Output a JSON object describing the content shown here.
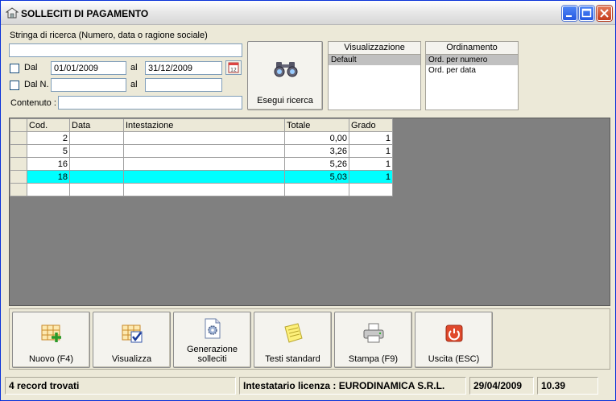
{
  "window": {
    "title": "SOLLECITI DI PAGAMENTO"
  },
  "search": {
    "label": "Stringa di ricerca (Numero, data o ragione sociale)",
    "value": "",
    "dal_label": "Dal",
    "date_from": "01/01/2009",
    "al_label": "al",
    "date_to": "31/12/2009",
    "daln_label": "Dal N.",
    "num_from": "",
    "al2_label": "al",
    "num_to": "",
    "contenuto_label": "Contenuto :",
    "contenuto_value": "",
    "button_label": "Esegui ricerca"
  },
  "visualizzazione": {
    "header": "Visualizzazione",
    "items": [
      "Default"
    ]
  },
  "ordinamento": {
    "header": "Ordinamento",
    "items": [
      "Ord. per numero",
      "Ord. per data"
    ]
  },
  "grid": {
    "columns": [
      "Cod.",
      "Data",
      "Intestazione",
      "Totale",
      "Grado"
    ],
    "rows": [
      {
        "cod": "2",
        "data": "",
        "intestazione": "",
        "totale": "0,00",
        "grado": "1"
      },
      {
        "cod": "5",
        "data": "",
        "intestazione": "",
        "totale": "3,26",
        "grado": "1"
      },
      {
        "cod": "16",
        "data": "",
        "intestazione": "",
        "totale": "5,26",
        "grado": "1"
      },
      {
        "cod": "18",
        "data": "",
        "intestazione": "",
        "totale": "5,03",
        "grado": "1"
      }
    ]
  },
  "toolbar": {
    "nuovo": "Nuovo (F4)",
    "visualizza": "Visualizza",
    "generazione_1": "Generazione",
    "generazione_2": "solleciti",
    "testi": "Testi standard",
    "stampa": "Stampa (F9)",
    "uscita": "Uscita (ESC)"
  },
  "status": {
    "records": "4 record trovati",
    "license": "Intestatario licenza : EURODINAMICA S.R.L.",
    "date": "29/04/2009",
    "time": "10.39"
  },
  "colors": {
    "highlight_row": "#00ffff",
    "grid_background": "#808080",
    "window_face": "#ece9d8"
  }
}
